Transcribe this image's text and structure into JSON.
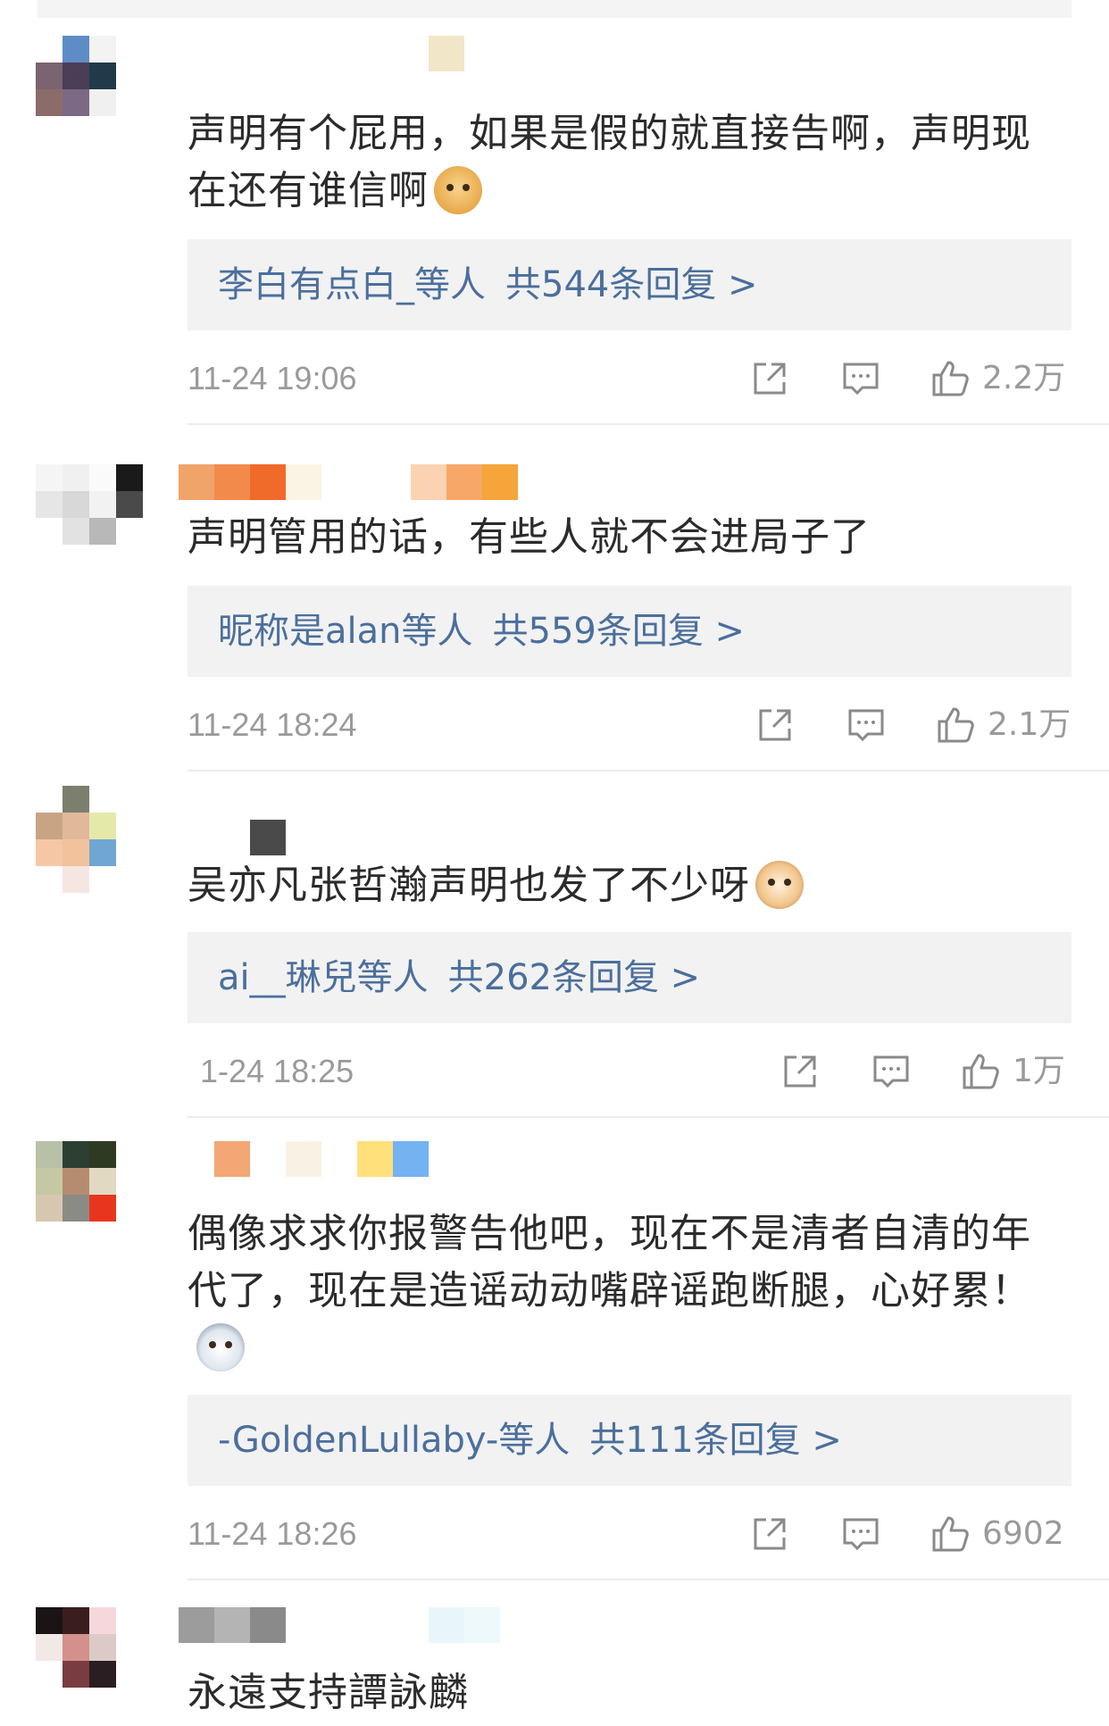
{
  "comments": [
    {
      "text": "声明有个屁用，如果是假的就直接告啊，声明现在还有谁信啊",
      "emoji": "doge-emoji",
      "reply_who": "李白有点白_",
      "reply_etc": "等人",
      "reply_total": "共544条回复 >",
      "time": "11-24 19:06",
      "likes": "2.2万"
    },
    {
      "text": "声明管用的话，有些人就不会进局子了",
      "emoji": "",
      "reply_who": "昵称是alan",
      "reply_etc": "等人",
      "reply_total": "共559条回复 >",
      "time": "11-24 18:24",
      "likes": "2.1万"
    },
    {
      "text": "吴亦凡张哲瀚声明也发了不少呀",
      "emoji": "cat-emoji",
      "reply_who": "ai__琳兒",
      "reply_etc": "等人",
      "reply_total": "共262条回复 >",
      "time": "1-24 18:25",
      "likes": "1万"
    },
    {
      "text": "偶像求求你报警告他吧，现在不是清者自清的年代了，现在是造谣动动嘴辟谣跑断腿，心好累！",
      "emoji": "husky-emoji",
      "reply_who": "-GoldenLullaby-",
      "reply_etc": "等人",
      "reply_total": "共111条回复 >",
      "time": "11-24 18:26",
      "likes": "6902"
    },
    {
      "text": "永遠支持譚詠麟"
    }
  ],
  "icons": {
    "share": "share-icon",
    "comment": "comment-icon",
    "like": "like-icon"
  },
  "colors": {
    "link": "#4b6f9c",
    "meta": "#9a9a9a",
    "reply_bg": "#f2f2f2"
  }
}
